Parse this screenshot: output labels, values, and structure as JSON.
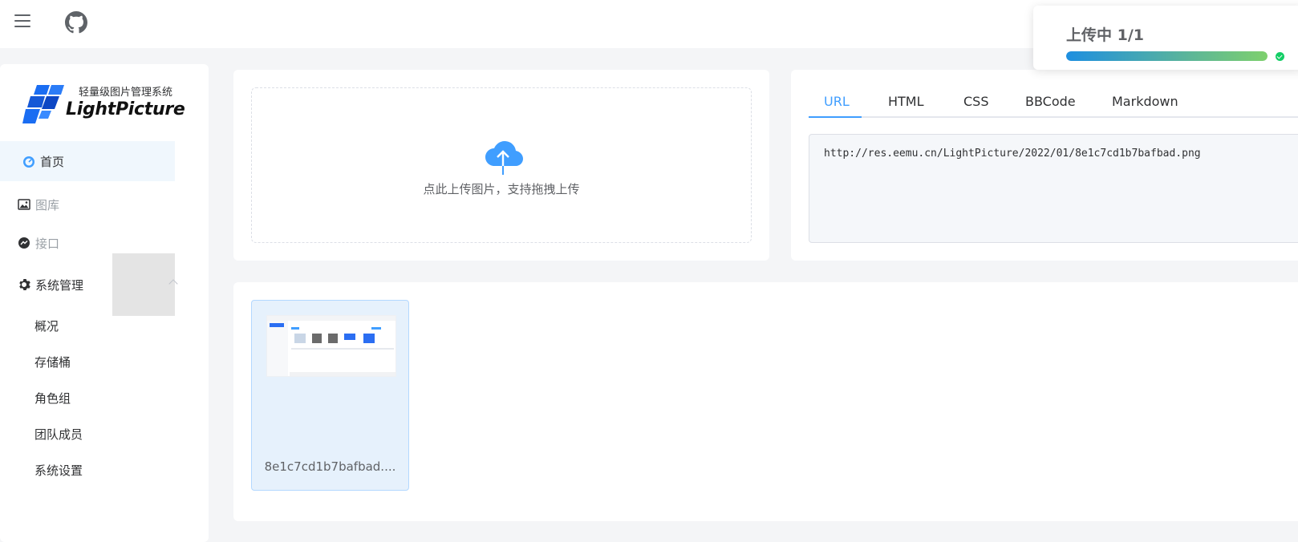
{
  "header": {
    "menu_icon": "hamburger-icon",
    "github_icon": "github-icon"
  },
  "toast": {
    "title": "上传中 1/1",
    "progress": 1.0,
    "status_icon": "check-circle-icon"
  },
  "logo": {
    "subtitle": "轻量级图片管理系统",
    "name": "LightPicture"
  },
  "sidebar": {
    "items": [
      {
        "label": "首页",
        "icon": "dashboard-icon",
        "active": true
      },
      {
        "label": "图库",
        "icon": "image-icon"
      },
      {
        "label": "接口",
        "icon": "messenger-icon"
      },
      {
        "label": "系统管理",
        "icon": "gear-icon",
        "expanded": true
      }
    ],
    "visible_labels": {
      "gallery": "图库",
      "api": "接口"
    },
    "system_subitems": [
      "概况",
      "存储桶",
      "角色组",
      "团队成员",
      "系统设置"
    ]
  },
  "upload": {
    "hint": "点此上传图片，支持拖拽上传",
    "icon": "cloud-upload-icon"
  },
  "links": {
    "tabs": [
      "URL",
      "HTML",
      "CSS",
      "BBCode",
      "Markdown"
    ],
    "active_tab": "URL",
    "value": "http://res.eemu.cn/LightPicture/2022/01/8e1c7cd1b7bafbad.png"
  },
  "gallery": {
    "items": [
      {
        "name": "8e1c7cd1b7bafbad...."
      }
    ]
  },
  "colors": {
    "accent": "#409eff",
    "active_bg": "#f0f7fd",
    "success": "#13ce66"
  }
}
